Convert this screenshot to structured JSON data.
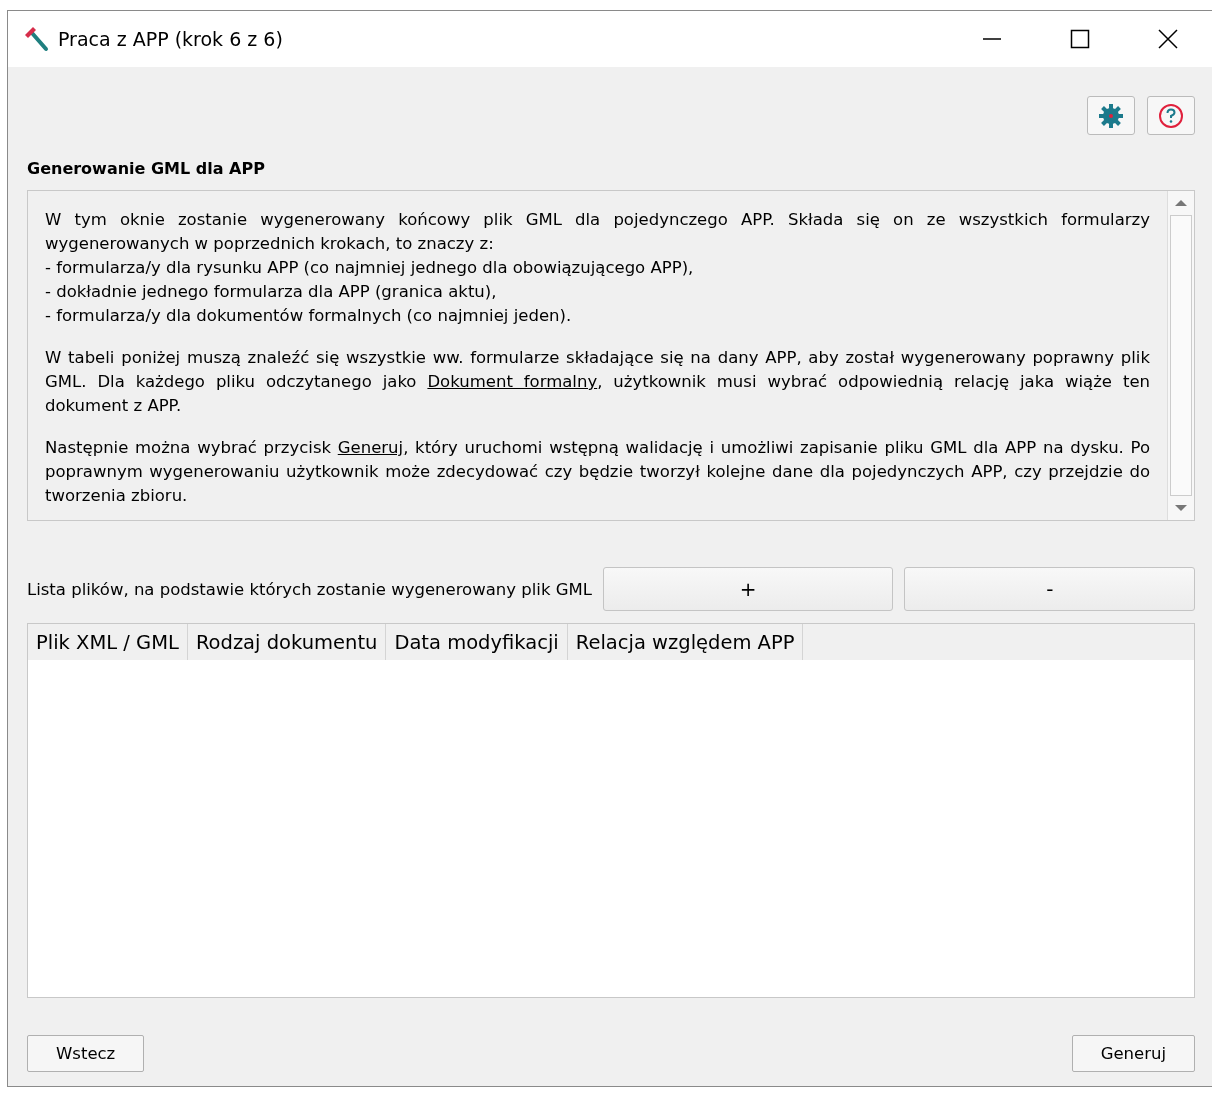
{
  "window": {
    "title": "Praca z APP (krok 6 z 6)"
  },
  "toolbar": {
    "buttons": [
      {
        "kind": "settings"
      },
      {
        "kind": "help"
      }
    ]
  },
  "heading": "Generowanie GML dla APP",
  "description": {
    "blocks": [
      {
        "kind": "paragraph",
        "parts": [
          {
            "kind": "text",
            "text": "W tym oknie zostanie wygenerowany końcowy plik GML dla pojedynczego APP. Składa się on ze wszystkich formularzy wygenerowanych w poprzednich krokach, to znaczy z:"
          }
        ]
      },
      {
        "kind": "line",
        "parts": [
          {
            "kind": "text",
            "text": "- formularza/y dla rysunku APP (co najmniej jednego dla obowiązującego APP),"
          }
        ]
      },
      {
        "kind": "line",
        "parts": [
          {
            "kind": "text",
            "text": "- dokładnie jednego formularza dla APP (granica aktu),"
          }
        ]
      },
      {
        "kind": "line",
        "parts": [
          {
            "kind": "text",
            "text": "- formularza/y dla dokumentów formalnych (co najmniej jeden)."
          }
        ]
      },
      {
        "kind": "paragraph",
        "parts": [
          {
            "kind": "text",
            "text": "W tabeli poniżej muszą znaleźć się wszystkie ww. formularze składające się na dany APP, aby został wygenerowany poprawny plik GML. Dla każdego pliku odczytanego jako "
          },
          {
            "kind": "link",
            "text": "Dokument formalny"
          },
          {
            "kind": "text",
            "text": ", użytkownik musi wybrać odpowiednią relację jaka wiąże ten dokument z APP."
          }
        ]
      },
      {
        "kind": "paragraph",
        "parts": [
          {
            "kind": "text",
            "text": "Następnie można wybrać przycisk "
          },
          {
            "kind": "link",
            "text": "Generuj"
          },
          {
            "kind": "text",
            "text": ", który uruchomi wstępną walidację i umożliwi zapisanie pliku GML dla APP na dysku. Po poprawnym wygenerowaniu użytkownik może zdecydować czy będzie tworzył kolejne dane dla pojedynczych APP, czy przejdzie do tworzenia zbioru."
          }
        ]
      }
    ]
  },
  "files": {
    "label": "Lista plików, na podstawie których zostanie wygenerowany plik GML",
    "buttons": [
      "+",
      "-"
    ]
  },
  "table": {
    "columns": [
      "Plik XML / GML",
      "Rodzaj dokumentu",
      "Data modyfikacji",
      "Relacja względem APP"
    ]
  },
  "footer": {
    "back": "Wstecz",
    "generate": "Generuj"
  }
}
